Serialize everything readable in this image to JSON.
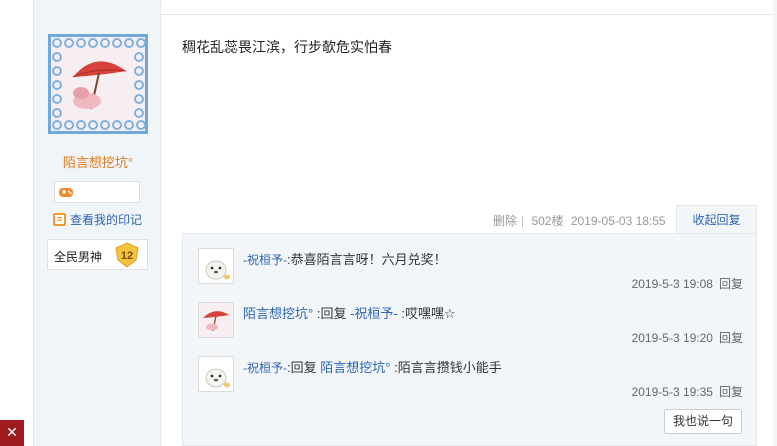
{
  "close_tab": {
    "icon": "close-icon",
    "glyph": "✕"
  },
  "author": {
    "username": "陌言想挖坑°",
    "imprint_label": "查看我的印记",
    "level_name": "全民男神",
    "level_number": "12"
  },
  "post": {
    "content": "稠花乱蕊畏江滨，行步欹危实怕春",
    "delete_label": "删除",
    "floor": "502楼",
    "timestamp": "2019-05-03 18:55",
    "toggle_label": "收起回复"
  },
  "replies": [
    {
      "user": "-祝桓予-",
      "prefix": ":",
      "reply_word": "",
      "target": "",
      "text": "恭喜陌言言呀！六月兑奖！",
      "time": "2019-5-3 19:08",
      "reply_label": "回复"
    },
    {
      "user": "陌言想挖坑°",
      "prefix": ":",
      "reply_word": "回复 ",
      "target": "-祝桓予-",
      "text": ":哎嘿嘿☆",
      "time": "2019-5-3 19:20",
      "reply_label": "回复"
    },
    {
      "user": "-祝桓予-",
      "prefix": ":",
      "reply_word": "回复 ",
      "target": "陌言想挖坑°",
      "text": ":陌言言攒钱小能手",
      "time": "2019-5-3 19:35",
      "reply_label": "回复"
    }
  ],
  "say_button_label": "我也说一句",
  "colors": {
    "link": "#2d64b3",
    "username": "#e07a1a",
    "close": "#9e1c20"
  }
}
